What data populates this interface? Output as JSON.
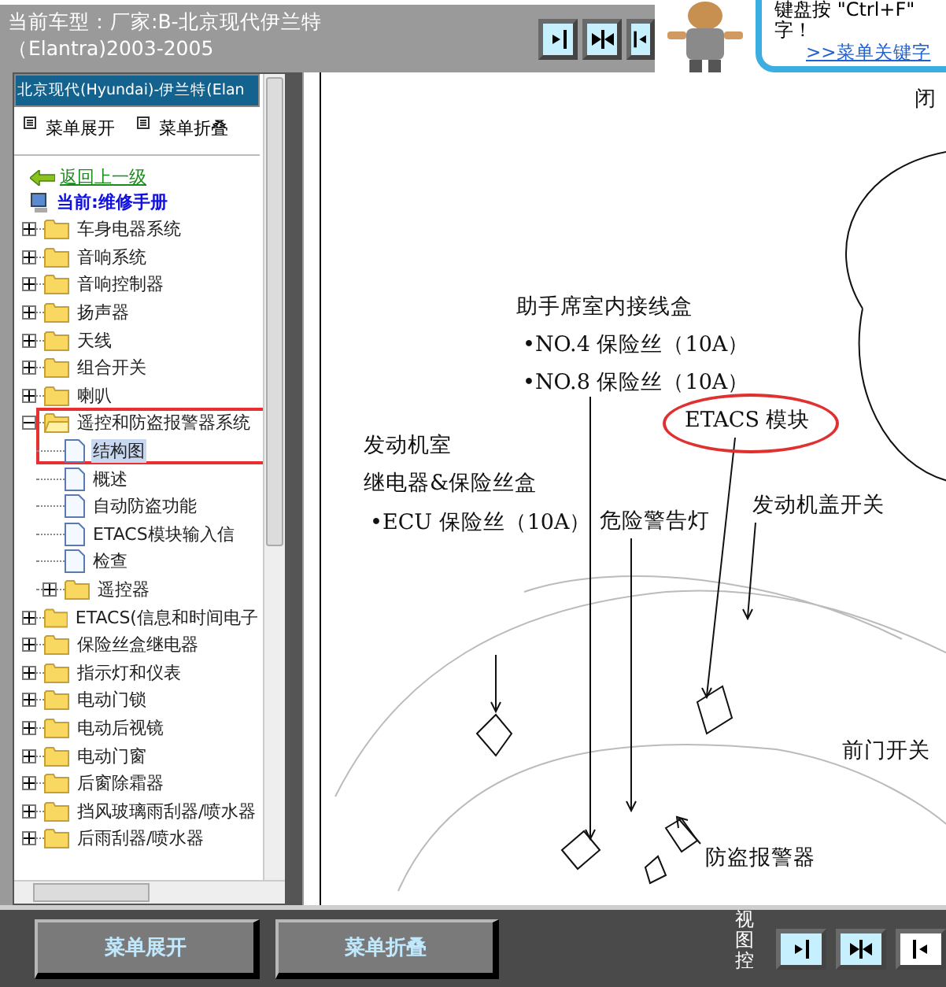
{
  "top_bar": {
    "vehicle": "当前车型：厂家:B-北京现代伊兰特（Elantra)2003-2005",
    "ad": {
      "text": "键盘按 \"Ctrl+F\" 字！",
      "link": ">>菜单关键字"
    }
  },
  "sidebar": {
    "header": "北京现代(Hyundai)-伊兰特(Elan",
    "toolbar": [
      "菜单展开",
      "菜单折叠"
    ],
    "back_link": "返回上一级",
    "current": "当前:维修手册",
    "tree": [
      {
        "label": "车身电器系统",
        "kind": "folder",
        "expanded": false,
        "selected": false
      },
      {
        "label": "音响系统",
        "kind": "folder",
        "expanded": false,
        "selected": false
      },
      {
        "label": "音响控制器",
        "kind": "folder",
        "expanded": false,
        "selected": false
      },
      {
        "label": "扬声器",
        "kind": "folder",
        "expanded": false,
        "selected": false
      },
      {
        "label": "天线",
        "kind": "folder",
        "expanded": false,
        "selected": false
      },
      {
        "label": "组合开关",
        "kind": "folder",
        "expanded": false,
        "selected": false
      },
      {
        "label": "喇叭",
        "kind": "folder",
        "expanded": false,
        "selected": false
      },
      {
        "label": "遥控和防盗报警器系统",
        "kind": "folder",
        "expanded": true,
        "selected": false,
        "children": [
          {
            "label": "结构图",
            "kind": "doc",
            "selected": true
          },
          {
            "label": "概述",
            "kind": "doc",
            "selected": false
          },
          {
            "label": "自动防盗功能",
            "kind": "doc",
            "selected": false
          },
          {
            "label": "ETACS模块输入信",
            "kind": "doc",
            "selected": false
          },
          {
            "label": "检查",
            "kind": "doc",
            "selected": false
          },
          {
            "label": "遥控器",
            "kind": "folder",
            "expanded": false,
            "selected": false
          }
        ]
      },
      {
        "label": "ETACS(信息和时间电子",
        "kind": "folder",
        "expanded": false,
        "selected": false
      },
      {
        "label": "保险丝盒继电器",
        "kind": "folder",
        "expanded": false,
        "selected": false
      },
      {
        "label": "指示灯和仪表",
        "kind": "folder",
        "expanded": false,
        "selected": false
      },
      {
        "label": "电动门锁",
        "kind": "folder",
        "expanded": false,
        "selected": false
      },
      {
        "label": "电动后视镜",
        "kind": "folder",
        "expanded": false,
        "selected": false
      },
      {
        "label": "电动门窗",
        "kind": "folder",
        "expanded": false,
        "selected": false
      },
      {
        "label": "后窗除霜器",
        "kind": "folder",
        "expanded": false,
        "selected": false
      },
      {
        "label": "挡风玻璃雨刮器/喷水器",
        "kind": "folder",
        "expanded": false,
        "selected": false
      },
      {
        "label": "后雨刮器/喷水器",
        "kind": "folder",
        "expanded": false,
        "selected": false
      }
    ]
  },
  "diagram": {
    "labels": [
      {
        "text": "闭",
        "circled": false
      },
      {
        "text": "助手席室内接线盒",
        "circled": false
      },
      {
        "text": "•NO.4 保险丝（10A）",
        "circled": false
      },
      {
        "text": "•NO.8 保险丝（10A）",
        "circled": false
      },
      {
        "text": "ETACS 模块",
        "circled": true
      },
      {
        "text": "发动机室",
        "circled": false
      },
      {
        "text": "继电器&保险丝盒",
        "circled": false
      },
      {
        "text": "•ECU 保险丝（10A）",
        "circled": false
      },
      {
        "text": "危险警告灯",
        "circled": false
      },
      {
        "text": "发动机盖开关",
        "circled": false
      },
      {
        "text": "前门开关",
        "circled": false
      },
      {
        "text": "防盗报警器",
        "circled": false
      }
    ]
  },
  "bottom_bar": {
    "buttons": [
      "菜单展开",
      "菜单折叠"
    ],
    "view_label": "视图控"
  }
}
